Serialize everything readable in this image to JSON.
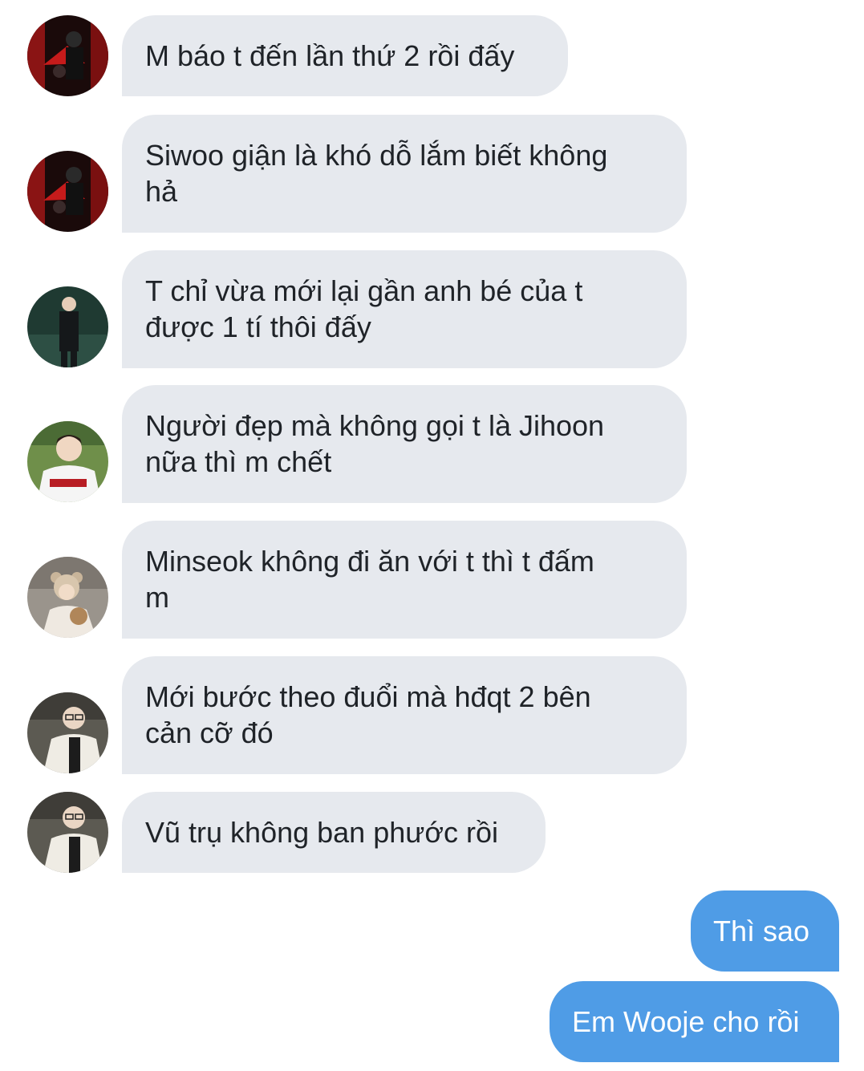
{
  "conversation": {
    "incoming": [
      {
        "avatar": "red-fan-avatar",
        "text": "M báo t đến lần thứ 2 rồi đấy"
      },
      {
        "avatar": "red-fan-avatar",
        "text": "Siwoo giận là khó dỗ lắm biết không\nhả"
      },
      {
        "avatar": "suit-avatar",
        "text": "T chỉ vừa mới lại gần anh bé của t\nđược 1 tí thôi đấy"
      },
      {
        "avatar": "jersey-avatar",
        "text": "Người đẹp mà không gọi t là Jihoon\nnữa thì m chết"
      },
      {
        "avatar": "bear-hat-avatar",
        "text": "Minseok không đi ăn với t thì t đấm\nm"
      },
      {
        "avatar": "glasses-avatar",
        "text": "Mới bước theo đuổi mà hđqt 2 bên\ncản cỡ đó"
      },
      {
        "avatar": "glasses-avatar",
        "text": "Vũ trụ không ban phước rồi"
      }
    ],
    "outgoing": [
      {
        "text": "Thì sao"
      },
      {
        "text": "Em Wooje cho rồi"
      }
    ]
  },
  "colors": {
    "incoming_bubble": "#e6e9ee",
    "outgoing_bubble": "#4f9ce6",
    "incoming_text": "#1f2328",
    "outgoing_text": "#ffffff"
  }
}
